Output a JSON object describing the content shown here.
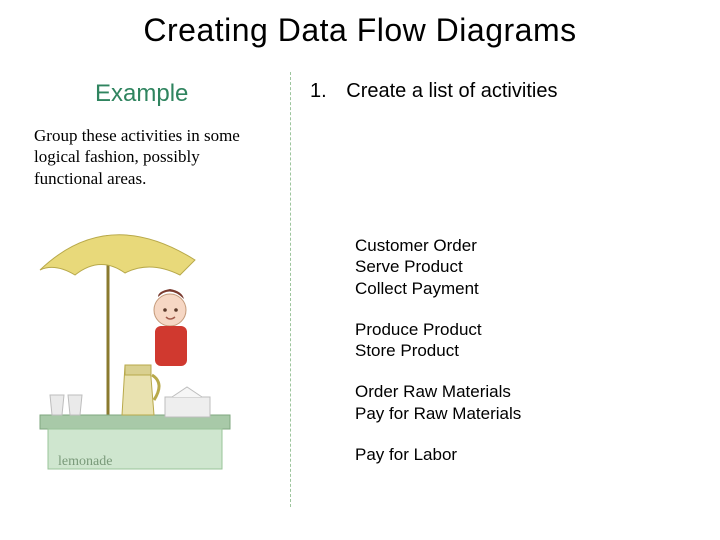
{
  "title": "Creating Data Flow Diagrams",
  "example_label": "Example",
  "note": "Group these activities in some logical fashion, possibly functional areas.",
  "step": {
    "num": "1.",
    "text": "Create a list of activities"
  },
  "groups": [
    [
      "Customer Order",
      "Serve Product",
      "Collect Payment"
    ],
    [
      "Produce Product",
      "Store Product"
    ],
    [
      "Order Raw Materials",
      "Pay for Raw Materials"
    ],
    [
      "Pay for Labor"
    ]
  ]
}
